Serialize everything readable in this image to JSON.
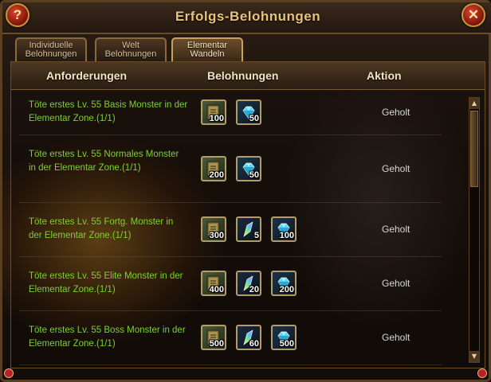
{
  "window": {
    "title": "Erfolgs-Belohnungen",
    "help_label": "?",
    "close_label": "✕"
  },
  "tabs": [
    {
      "line1": "Individuelle",
      "line2": "Belohnungen",
      "active": false
    },
    {
      "line1": "Welt",
      "line2": "Belohnungen",
      "active": false
    },
    {
      "line1": "Elementar",
      "line2": "Wandeln",
      "active": true
    }
  ],
  "table": {
    "headers": {
      "requirements": "Anforderungen",
      "rewards": "Belohnungen",
      "action": "Aktion"
    },
    "rows": [
      {
        "requirement": "Töte erstes Lv. 55 Basis Monster in der Elementar Zone.(1/1)",
        "rewards": [
          {
            "icon": "spellbook-icon",
            "qty": "100"
          },
          {
            "icon": "blue-gem-icon",
            "qty": "50"
          }
        ],
        "action": "Geholt"
      },
      {
        "requirement": "Töte erstes Lv. 55 Normales Monster in der Elementar Zone.(1/1)",
        "rewards": [
          {
            "icon": "spellbook-icon",
            "qty": "200"
          },
          {
            "icon": "blue-gem-icon",
            "qty": "50"
          }
        ],
        "action": "Geholt"
      },
      {
        "requirement": "Töte erstes Lv. 55 Fortg. Monster in der Elementar Zone.(1/1)",
        "rewards": [
          {
            "icon": "spellbook-icon",
            "qty": "300"
          },
          {
            "icon": "rainbow-crystal-icon",
            "qty": "5"
          },
          {
            "icon": "blue-gem-icon",
            "qty": "100"
          }
        ],
        "action": "Geholt"
      },
      {
        "requirement": "Töte erstes Lv. 55 Elite Monster in der Elementar Zone.(1/1)",
        "rewards": [
          {
            "icon": "spellbook-icon",
            "qty": "400"
          },
          {
            "icon": "rainbow-crystal-icon",
            "qty": "20"
          },
          {
            "icon": "blue-gem-icon",
            "qty": "200"
          }
        ],
        "action": "Geholt"
      },
      {
        "requirement": "Töte erstes Lv. 55 Boss Monster in der Elementar Zone.(1/1)",
        "rewards": [
          {
            "icon": "spellbook-icon",
            "qty": "500"
          },
          {
            "icon": "rainbow-crystal-icon",
            "qty": "60"
          },
          {
            "icon": "blue-gem-icon",
            "qty": "500"
          }
        ],
        "action": "Geholt"
      }
    ]
  },
  "colors": {
    "requirement_text": "#7cd22a",
    "title_text": "#e8c27a",
    "action_text": "#d6d6d6"
  }
}
